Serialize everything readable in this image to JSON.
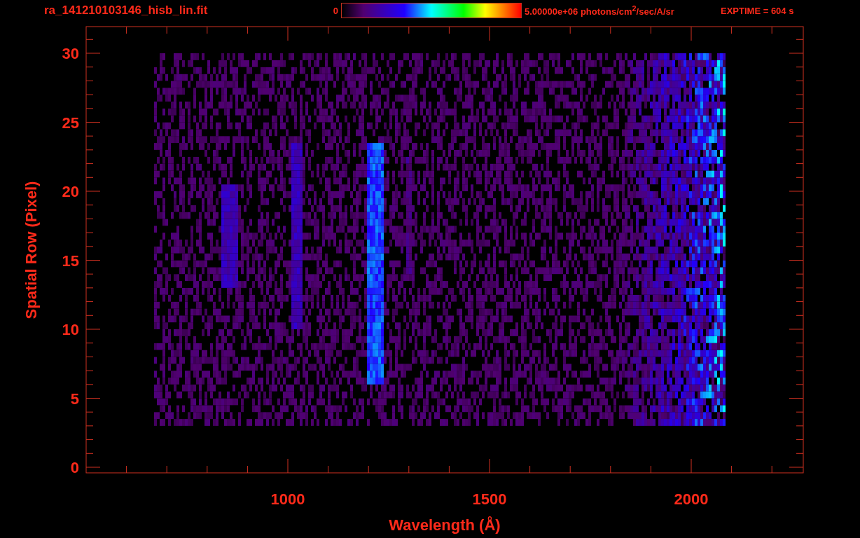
{
  "header": {
    "title": "ra_141210103146_hisb_lin.fit",
    "colorbar_min": "0",
    "colorbar_max": "5.00000e+06 photons/cm$^{2}$/sec/A/sr",
    "exposure": "EXPTIME = 604 s"
  },
  "plot": {
    "xlabel": "Wavelength (Å)",
    "ylabel": "Spatial Row (Pixel)",
    "yticks": [
      "30",
      "25",
      "20",
      "15",
      "10",
      "5",
      "0"
    ],
    "xticks": [
      "1000",
      "1500",
      "2000"
    ]
  }
}
